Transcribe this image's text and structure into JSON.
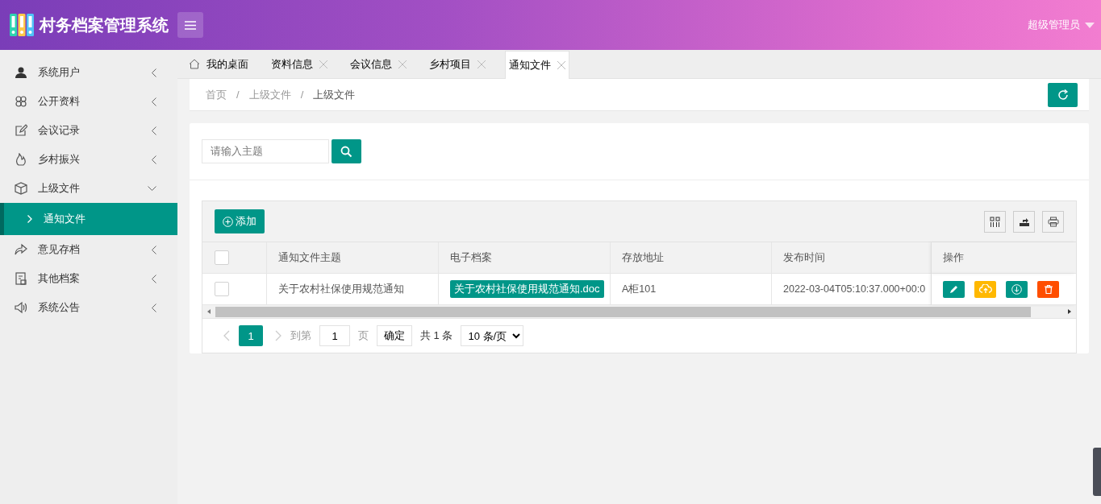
{
  "header": {
    "title": "村务档案管理系统",
    "user": "超级管理员"
  },
  "sidebar": {
    "items": [
      {
        "label": "系统用户",
        "expanded": false
      },
      {
        "label": "公开资料",
        "expanded": false
      },
      {
        "label": "会议记录",
        "expanded": false
      },
      {
        "label": "乡村振兴",
        "expanded": false
      },
      {
        "label": "上级文件",
        "expanded": true,
        "children": [
          {
            "label": "通知文件",
            "selected": true
          }
        ]
      },
      {
        "label": "意见存档",
        "expanded": false
      },
      {
        "label": "其他档案",
        "expanded": false
      },
      {
        "label": "系统公告",
        "expanded": false
      }
    ]
  },
  "tabs": [
    {
      "label": "我的桌面",
      "kind": "home",
      "selected": false
    },
    {
      "label": "资料信息",
      "kind": "closable",
      "selected": false
    },
    {
      "label": "会议信息",
      "kind": "closable",
      "selected": false
    },
    {
      "label": "乡村项目",
      "kind": "closable",
      "selected": false
    },
    {
      "label": "通知文件",
      "kind": "closable",
      "selected": true
    }
  ],
  "breadcrumb": {
    "items": [
      "首页",
      "上级文件",
      "上级文件"
    ],
    "separators": [
      "/",
      "/"
    ]
  },
  "search": {
    "placeholder": "请输入主题"
  },
  "table": {
    "add_button": "添加",
    "header_checked": false,
    "columns": [
      "通知文件主题",
      "电子档案",
      "存放地址",
      "发布时间",
      "操作"
    ],
    "rows": [
      {
        "checked": false,
        "subject": "关于农村社保使用规范通知",
        "file": "关于农村社保使用规范通知.doc",
        "location": "A柜101",
        "time": "2022-03-04T05:10:37.000+00:0"
      }
    ]
  },
  "pagination": {
    "pages": [
      {
        "label": "1",
        "selected": true
      }
    ],
    "goto_label": "到第",
    "goto_value": "1",
    "page_label": "页",
    "confirm": "确定",
    "total": "共 1 条",
    "page_size": "10 条/页"
  }
}
